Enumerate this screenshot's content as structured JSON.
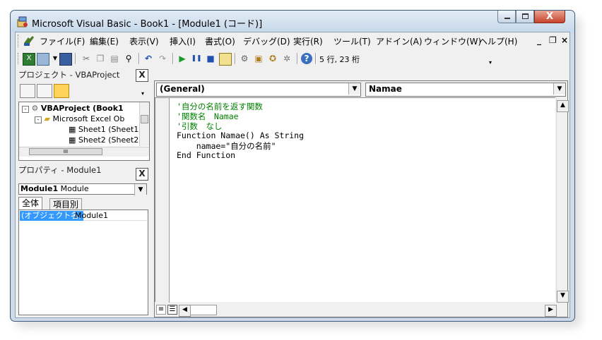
{
  "window": {
    "title": "Microsoft Visual Basic - Book1 - [Module1 (コード)]",
    "close_glyph": "X"
  },
  "menubar": {
    "items": [
      "ファイル(F)",
      "編集(E)",
      "表示(V)",
      "挿入(I)",
      "書式(O)",
      "デバッグ(D)",
      "実行(R)",
      "ツール(T)",
      "アドイン(A)",
      "ウィンドウ(W)",
      "ヘルプ(H)"
    ],
    "mdi_controls": [
      "_",
      "❐",
      "×"
    ]
  },
  "toolbar": {
    "cursor_position": "5 行, 23 桁"
  },
  "project_panel": {
    "title": "プロジェクト - VBAProject",
    "close": "X",
    "tree": {
      "root": "VBAProject (Book1",
      "folder": "Microsoft Excel Ob",
      "sheet1": "Sheet1 (Sheet1",
      "sheet2": "Sheet2 (Sheet2"
    },
    "scroll_mark": "III"
  },
  "properties_panel": {
    "title": "プロパティ - Module1",
    "close": "X",
    "object_bold": "Module1",
    "object_type": "Module",
    "tabs": [
      "全体",
      "項目別"
    ],
    "row_name": "(オブジェクト名)",
    "row_value": "Module1"
  },
  "code_window": {
    "object_combo": "(General)",
    "proc_combo": "Namae",
    "lines": [
      {
        "text": "'自分の名前を返す関数",
        "kind": "comment"
      },
      {
        "text": "'関数名　Namae",
        "kind": "comment"
      },
      {
        "text": "'引数　なし",
        "kind": "comment"
      },
      {
        "text": "Function Namae() As String",
        "kind": "code"
      },
      {
        "text": "    namae=\"自分の名前\"",
        "kind": "code"
      },
      {
        "text": "End Function",
        "kind": "code"
      }
    ]
  },
  "colors": {
    "comment": "#008000",
    "code": "#000000",
    "selected_row": "#3399ff"
  }
}
